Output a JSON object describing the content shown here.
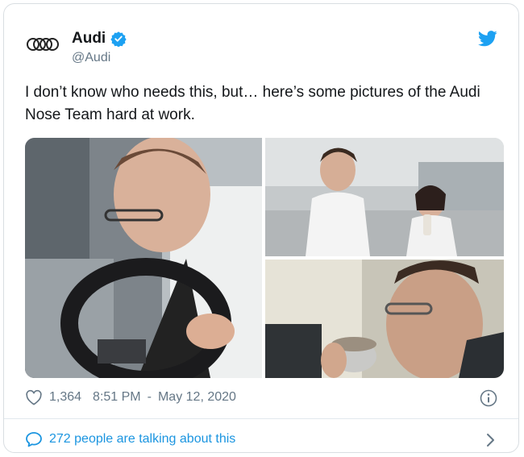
{
  "tweet": {
    "account": {
      "name": "Audi",
      "handle": "@Audi"
    },
    "text": "I don’t know who needs this, but… here’s some pictures of the Audi Nose Team hard at work.",
    "likes": "1,364",
    "time": "8:51 PM",
    "separator": "-",
    "date": "May 12, 2020",
    "conversation": "272 people are talking about this"
  },
  "colors": {
    "accent": "#1da1f2",
    "link": "#1b95e0",
    "muted": "#657786"
  },
  "icons": [
    "audi-rings-logo",
    "verified-badge-icon",
    "twitter-bird-icon",
    "heart-icon",
    "info-icon",
    "speech-bubble-icon",
    "chevron-right-icon"
  ]
}
